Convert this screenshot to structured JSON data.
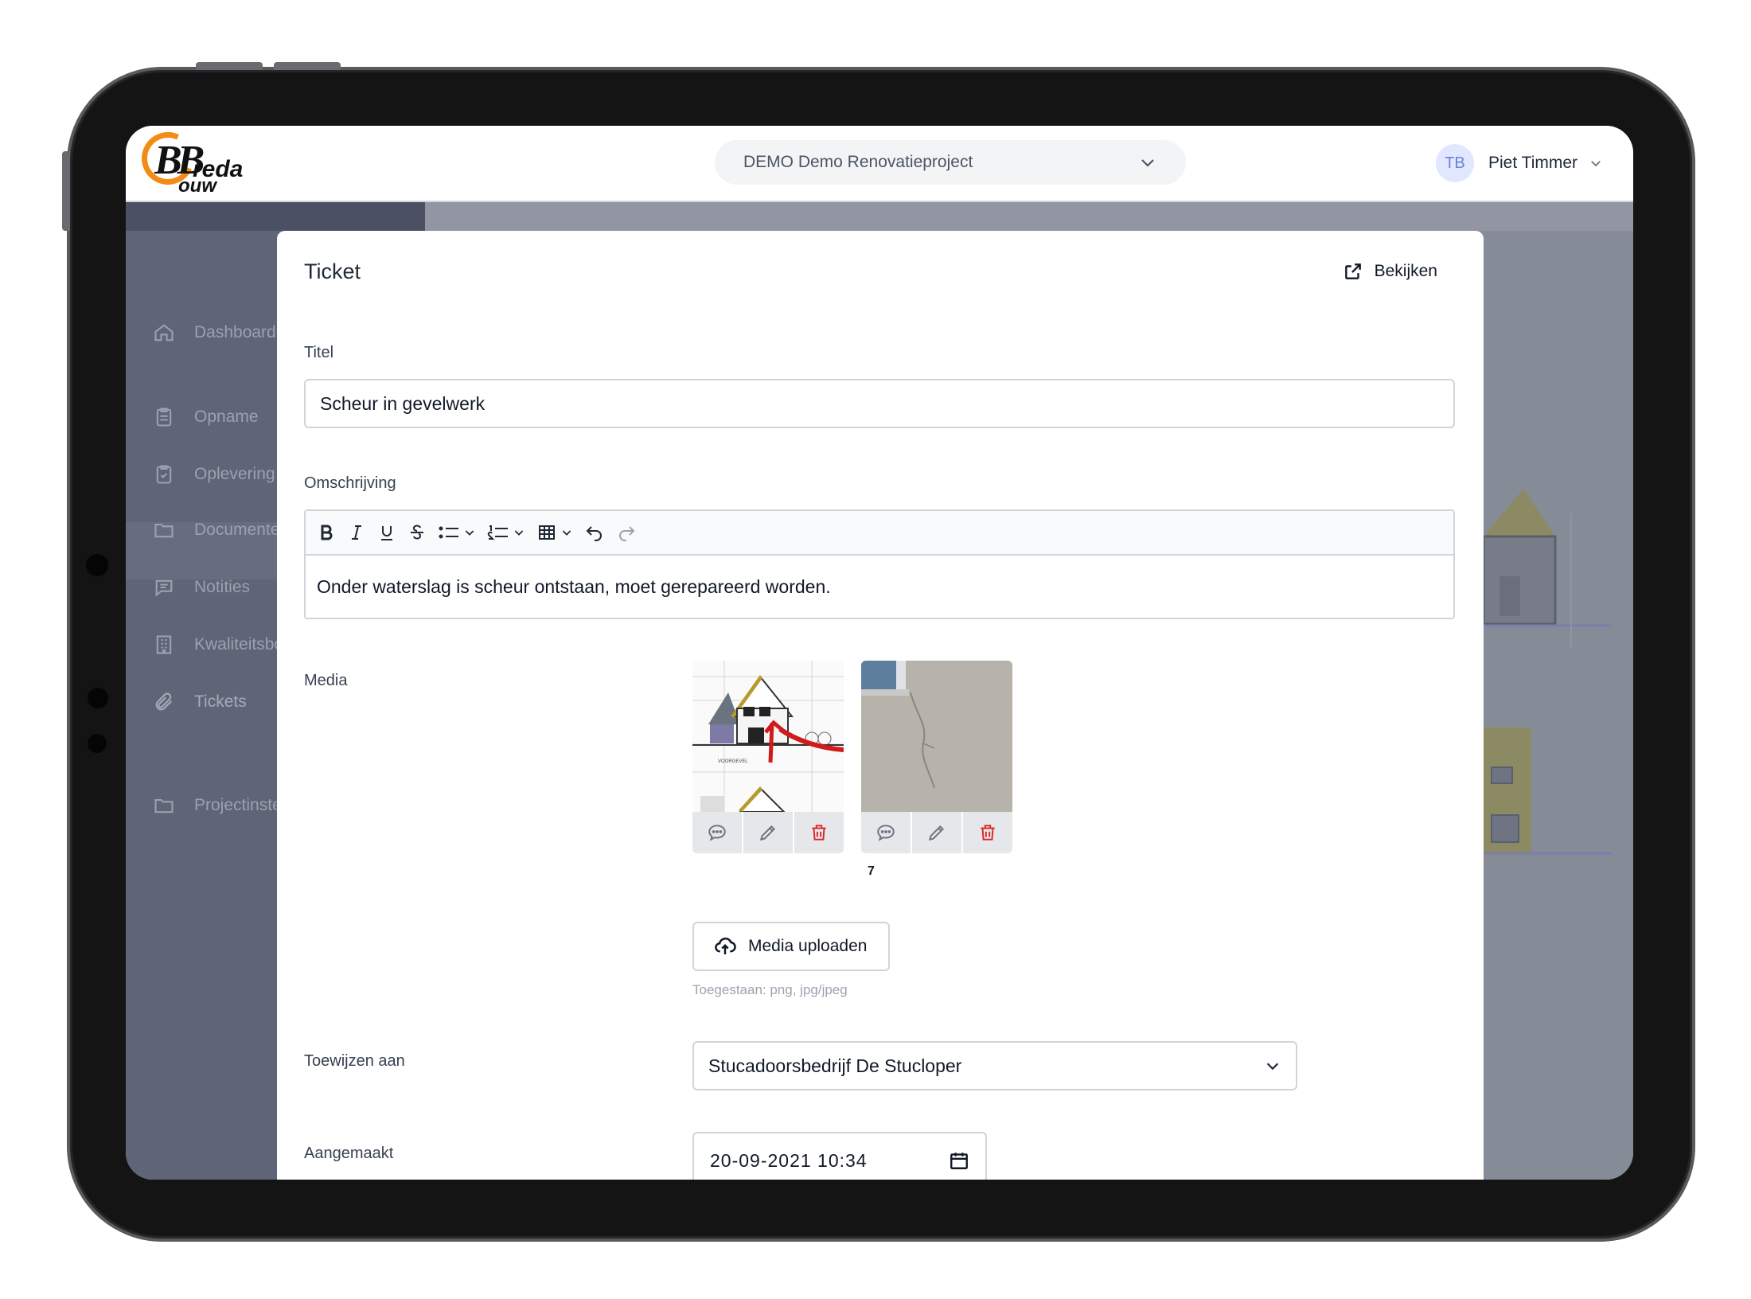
{
  "topbar": {
    "logo_text_b": "BB",
    "logo_text_line1": "reda",
    "logo_text_line2": "ouw",
    "project": "DEMO Demo Renovatieproject",
    "user_initials": "TB",
    "user_name": "Piet Timmer"
  },
  "sidebar": {
    "items": [
      {
        "label": "Dashboard",
        "icon": "home-icon"
      },
      {
        "label": "Opname",
        "icon": "clipboard-icon"
      },
      {
        "label": "Oplevering",
        "icon": "clipboard-check-icon"
      },
      {
        "label": "Documenten",
        "icon": "folder-icon"
      },
      {
        "label": "Notities",
        "icon": "chat-icon"
      },
      {
        "label": "Kwaliteitsborging",
        "icon": "building-icon"
      },
      {
        "label": "Tickets",
        "icon": "paperclip-icon"
      },
      {
        "label": "Projectinstellingen",
        "icon": "folder-icon"
      }
    ],
    "active": "Tickets"
  },
  "modal": {
    "title": "Ticket",
    "view_link": "Bekijken",
    "title_label": "Titel",
    "title_value": "Scheur in gevelwerk",
    "description_label": "Omschrijving",
    "description_value": "Onder waterslag is scheur ontstaan, moet gerepareerd worden.",
    "media_label": "Media",
    "media_count": "7",
    "upload_label": "Media uploaden",
    "upload_hint": "Toegestaan: png, jpg/jpeg",
    "assign_label": "Toewijzen aan",
    "assign_value": "Stucadoorsbedrijf De Stucloper",
    "created_label": "Aangemaakt",
    "created_value": "20-09-2021 10:34"
  },
  "colors": {
    "accent_orange": "#f28c16",
    "delete_red": "#dc2626",
    "overlay": "#868b98"
  }
}
